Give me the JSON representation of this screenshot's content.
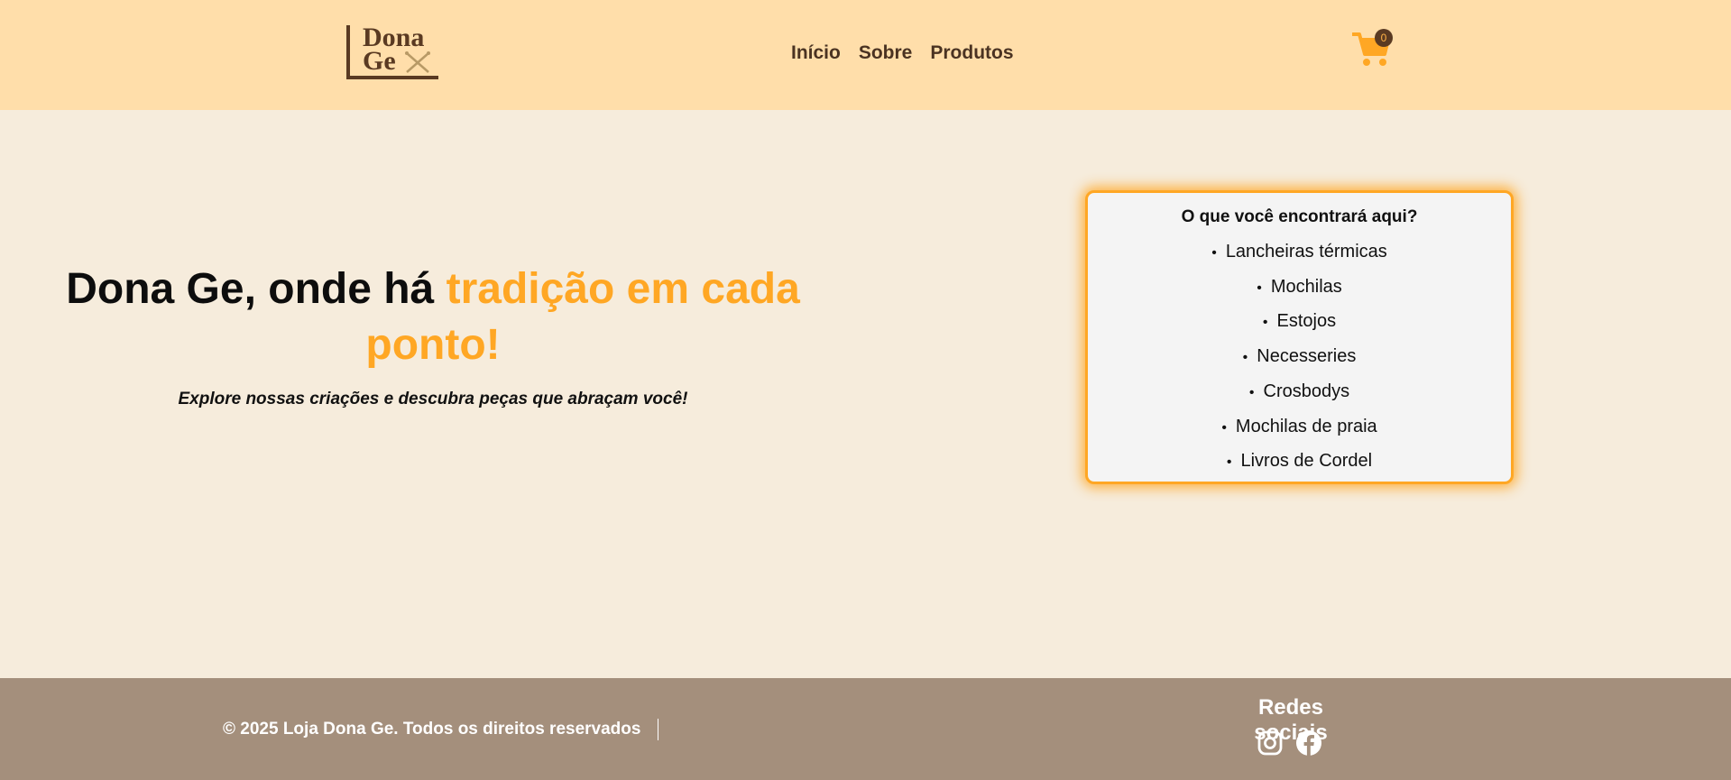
{
  "header": {
    "logo": {
      "line1": "Dona",
      "line2": "Ge"
    },
    "nav": [
      "Início",
      "Sobre",
      "Produtos"
    ],
    "cart": {
      "icon": "cart-icon",
      "count": "0"
    }
  },
  "hero": {
    "title_plain": "Dona Ge, onde há ",
    "title_accent": "tradição em cada ponto!",
    "subtitle": "Explore nossas criações e descubra peças que abraçam você!"
  },
  "card": {
    "title": "O que você encontrará aqui?",
    "items": [
      "Lancheiras térmicas",
      "Mochilas",
      "Estojos",
      "Necesseries",
      "Crosbodys",
      "Mochilas de praia",
      "Livros de Cordel"
    ]
  },
  "footer": {
    "copyright": "© 2025 Loja Dona Ge. Todos os direitos reservados",
    "social_title": "Redes sociais",
    "social_icons": [
      "instagram-icon",
      "facebook-icon"
    ]
  },
  "colors": {
    "header_bg": "#ffdeaa",
    "page_bg": "#f6ecdc",
    "accent": "#ffa724",
    "brown": "#5a3a22",
    "footer_bg": "#a48f7c"
  }
}
